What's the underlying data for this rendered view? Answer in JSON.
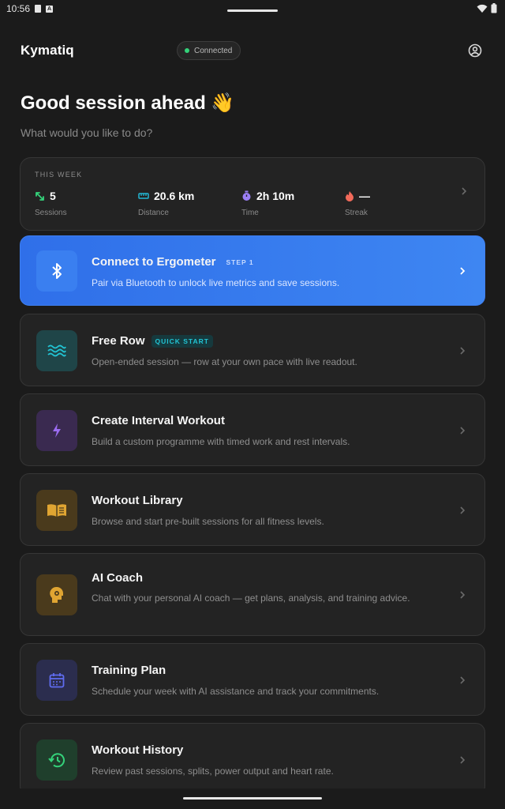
{
  "status_bar": {
    "time": "10:56",
    "notification_icons": [
      "sd-card-icon",
      "a-app-icon"
    ],
    "system_icons": [
      "wifi-icon",
      "battery-icon"
    ]
  },
  "header": {
    "brand": "Kymatiq",
    "connection": "Connected",
    "profile_icon": "user-circle-icon"
  },
  "greeting": {
    "title": "Good session ahead 👋",
    "subtitle": "What would you like to do?"
  },
  "week": {
    "label": "THIS WEEK",
    "stats": [
      {
        "value": "5",
        "caption": "Sessions",
        "icon": "arrows-diagonal-icon",
        "color": "#34d27a"
      },
      {
        "value": "20.6 km",
        "caption": "Distance",
        "icon": "ruler-icon",
        "color": "#22b8d4"
      },
      {
        "value": "2h 10m",
        "caption": "Time",
        "icon": "stopwatch-icon",
        "color": "#9b7ff5"
      },
      {
        "value": "—",
        "caption": "Streak",
        "icon": "flame-icon",
        "color": "#f26a5a"
      }
    ]
  },
  "cards": [
    {
      "title": "Connect to Ergometer",
      "badge": "STEP 1",
      "desc": "Pair via Bluetooth to unlock live metrics and save sessions.",
      "icon": "bluetooth-icon"
    },
    {
      "title": "Free Row",
      "badge": "QUICK START",
      "desc": "Open-ended session — row at your own pace with live readout.",
      "icon": "waves-icon"
    },
    {
      "title": "Create Interval Workout",
      "badge": "",
      "desc": "Build a custom programme with timed work and rest intervals.",
      "icon": "lightning-icon"
    },
    {
      "title": "Workout Library",
      "badge": "",
      "desc": "Browse and start pre-built sessions for all fitness levels.",
      "icon": "book-icon"
    },
    {
      "title": "AI Coach",
      "badge": "",
      "desc": "Chat with your personal AI coach — get plans, analysis, and training advice.",
      "icon": "coach-head-icon"
    },
    {
      "title": "Training Plan",
      "badge": "",
      "desc": "Schedule your week with AI assistance and track your commitments.",
      "icon": "calendar-icon"
    },
    {
      "title": "Workout History",
      "badge": "",
      "desc": "Review past sessions, splits, power output and heart rate.",
      "icon": "history-icon"
    }
  ],
  "colors": {
    "background": "#1b1b1b",
    "card": "#232323",
    "primary": "#3578ee",
    "quick_badge": "#22c4d4",
    "lightning": "#9b6cf0",
    "library": "#e0a532",
    "coach": "#e0a532",
    "plan": "#5f6cf0",
    "history": "#34d27a"
  }
}
